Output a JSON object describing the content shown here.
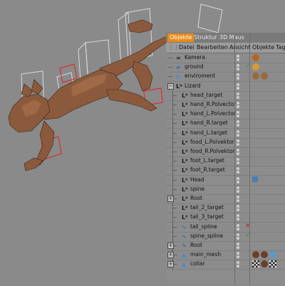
{
  "window": {
    "tabs": [
      {
        "label": "Objekte",
        "active": true
      },
      {
        "label": "Struktur",
        "active": false
      },
      {
        "label": "3D Maus",
        "active": false
      }
    ],
    "menu": [
      "Datei",
      "Bearbeiten",
      "Ansicht",
      "Objekte",
      "Tags"
    ]
  },
  "objects": [
    {
      "name": "Kamera",
      "icon": "camera-icon",
      "indent": 0,
      "expander": "",
      "flags": "none",
      "tags": [
        "texture-tag-icon"
      ]
    },
    {
      "name": "ground",
      "icon": "floor-icon",
      "indent": 0,
      "expander": "",
      "flags": "check",
      "tags": [
        "tag-icon"
      ]
    },
    {
      "name": "enviroment",
      "icon": "sky-icon",
      "indent": 0,
      "expander": "",
      "flags": "none",
      "tags": [
        "material-tag-icon",
        "material-tag-icon"
      ]
    },
    {
      "name": "Lizard",
      "icon": "null-object-icon",
      "indent": 0,
      "expander": "−",
      "flags": "none",
      "tags": []
    },
    {
      "name": "head_target",
      "icon": "null-object-icon",
      "indent": 1,
      "expander": "",
      "flags": "none",
      "tags": []
    },
    {
      "name": "hand_R.Polvector",
      "icon": "null-object-icon",
      "indent": 1,
      "expander": "",
      "flags": "none",
      "tags": []
    },
    {
      "name": "hand_L.Polvector",
      "icon": "null-object-icon",
      "indent": 1,
      "expander": "",
      "flags": "none",
      "tags": []
    },
    {
      "name": "hand_R.target",
      "icon": "null-object-icon",
      "indent": 1,
      "expander": "",
      "flags": "none",
      "tags": []
    },
    {
      "name": "hand_L.target",
      "icon": "null-object-icon",
      "indent": 1,
      "expander": "",
      "flags": "none",
      "tags": []
    },
    {
      "name": "food_L.Polvektor",
      "icon": "null-object-icon",
      "indent": 1,
      "expander": "",
      "flags": "none",
      "tags": []
    },
    {
      "name": "food_R.Polvektor",
      "icon": "null-object-icon",
      "indent": 1,
      "expander": "",
      "flags": "none",
      "tags": []
    },
    {
      "name": "foot_L.target",
      "icon": "null-object-icon",
      "indent": 1,
      "expander": "",
      "flags": "none",
      "tags": []
    },
    {
      "name": "foot_R.target",
      "icon": "null-object-icon",
      "indent": 1,
      "expander": "",
      "flags": "none",
      "tags": []
    },
    {
      "name": "Head",
      "icon": "null-object-icon",
      "indent": 1,
      "expander": "",
      "flags": "none",
      "tags": [
        "ik-tag-icon"
      ]
    },
    {
      "name": "spine",
      "icon": "null-object-icon",
      "indent": 1,
      "expander": "",
      "flags": "none",
      "tags": []
    },
    {
      "name": "Root",
      "icon": "null-object-icon",
      "indent": 1,
      "expander": "+",
      "flags": "none",
      "tags": []
    },
    {
      "name": "tail_2_target",
      "icon": "null-object-icon",
      "indent": 1,
      "expander": "",
      "flags": "none",
      "tags": []
    },
    {
      "name": "tail_3_target",
      "icon": "null-object-icon",
      "indent": 1,
      "expander": "",
      "flags": "none",
      "tags": []
    },
    {
      "name": "tail_spline",
      "icon": "spline-icon",
      "indent": 1,
      "expander": "",
      "flags": "redx",
      "tags": []
    },
    {
      "name": "spine_spline",
      "icon": "spline-icon",
      "indent": 1,
      "expander": "",
      "flags": "check",
      "tags": []
    },
    {
      "name": "Root",
      "icon": "joint-icon",
      "indent": 1,
      "expander": "+",
      "flags": "none",
      "tags": []
    },
    {
      "name": "main_mesh",
      "icon": "polygon-object-icon",
      "indent": 1,
      "expander": "+",
      "flags": "none",
      "tags": [
        "material-sphere-icon",
        "material-sphere-icon",
        "weight-tag-icon"
      ]
    },
    {
      "name": "collar",
      "icon": "polygon-object-icon",
      "indent": 1,
      "expander": "+",
      "flags": "none",
      "tags": [
        "checker-tag-icon",
        "material-sphere-icon",
        "checker-tag-icon"
      ]
    }
  ]
}
